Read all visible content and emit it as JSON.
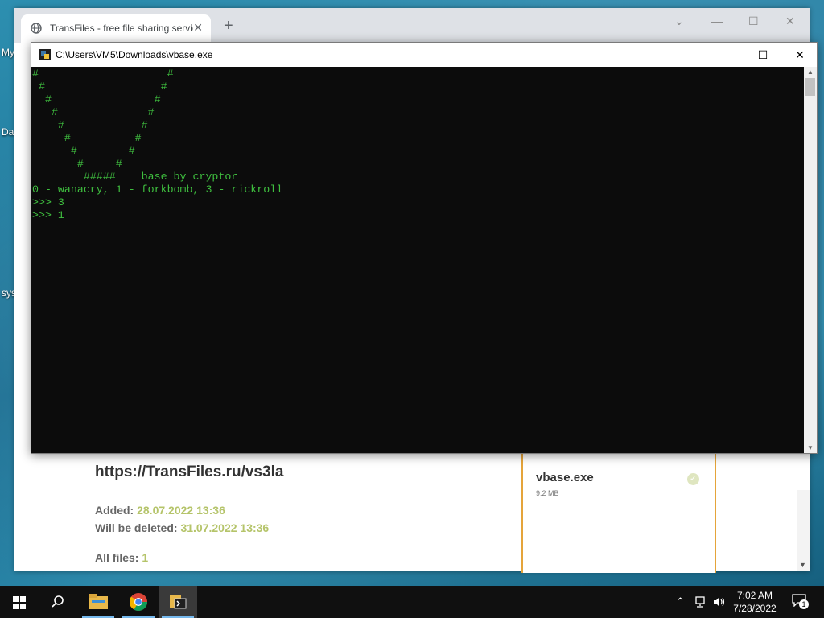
{
  "desktop": {
    "labels": [
      {
        "text": "My"
      },
      {
        "text": "Da"
      },
      {
        "text": "sys"
      }
    ]
  },
  "chrome": {
    "tab_title": "TransFiles - free file sharing service",
    "new_tab": "+",
    "page": {
      "link": "https://TransFiles.ru/vs3la",
      "added_label": "Added:",
      "added_value": "28.07.2022 13:36",
      "deleted_label": "Will be deleted:",
      "deleted_value": "31.07.2022 13:36",
      "all_files_label": "All files:",
      "all_files_value": "1",
      "file": {
        "name": "vbase.exe",
        "size": "9.2 MB"
      }
    }
  },
  "console": {
    "title": "C:\\Users\\VM5\\Downloads\\vbase.exe",
    "output": "#                    #\n #                  #\n  #                #\n   #              #\n    #            #\n     #          #\n      #        #\n       #     #\n        #####    base by cryptor\n0 - wanacry, 1 - forkbomb, 3 - rickroll\n>>> 3\n>>> 1"
  },
  "taskbar": {
    "time": "7:02 AM",
    "date": "7/28/2022",
    "notifications": "1",
    "icons": [
      "windows-start-icon",
      "search-icon",
      "file-explorer-icon",
      "chrome-icon",
      "console-app-icon"
    ]
  },
  "colors": {
    "console_text": "#3fbf3f",
    "console_bg": "#0c0c0c",
    "accent_value": "#b5c46a",
    "panel_border": "#e5a43a"
  }
}
